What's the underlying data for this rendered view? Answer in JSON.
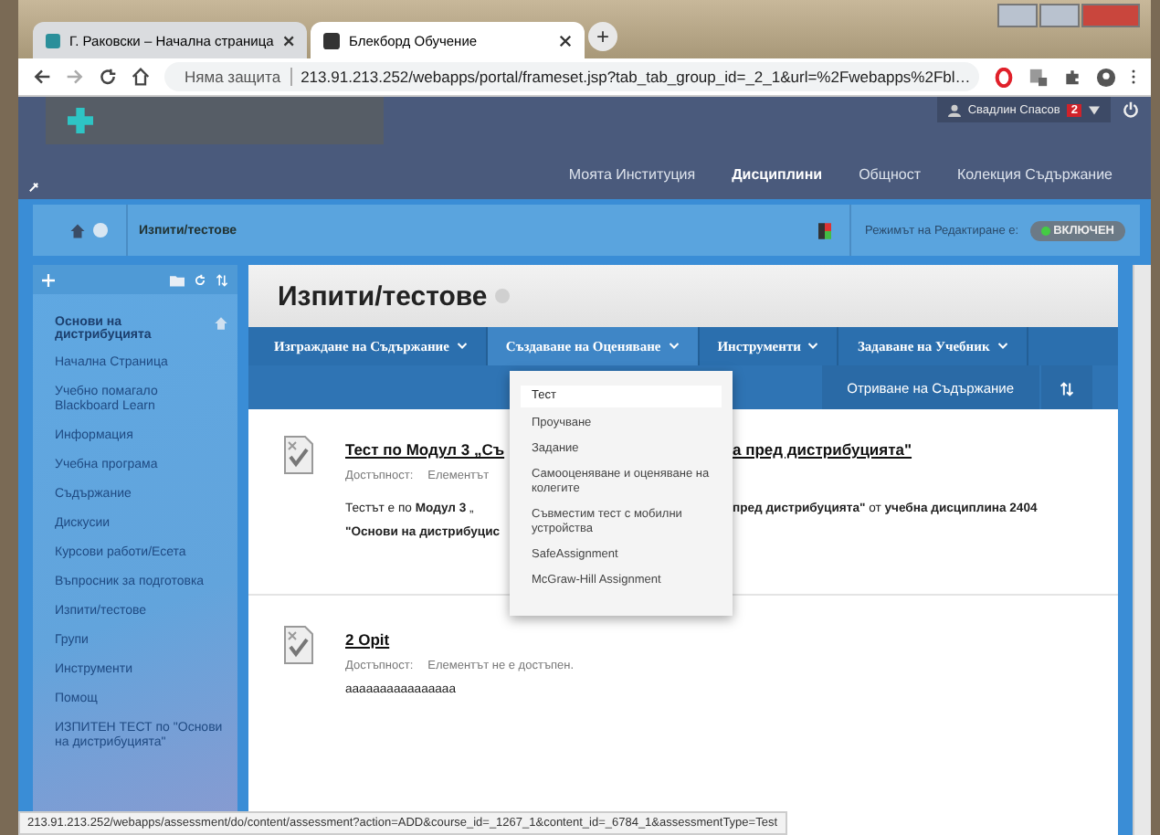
{
  "browser": {
    "tabs": [
      {
        "label": "Г. Раковски – Начална страница",
        "selected": false
      },
      {
        "label": "Блекборд Обучение",
        "selected": true
      }
    ],
    "new_tab": "+",
    "security": "Няма защита",
    "url": "213.91.213.252/webapps/portal/frameset.jsp?tab_tab_group_id=_2_1&url=%2Fwebapps%2Fbl…"
  },
  "header": {
    "user": "Свадлин Спасов",
    "notifications": "2",
    "nav": [
      {
        "label": "Моята Институция",
        "selected": false
      },
      {
        "label": "Дисциплини",
        "selected": true
      },
      {
        "label": "Общност",
        "selected": false
      },
      {
        "label": "Колекция Съдържание",
        "selected": false
      }
    ]
  },
  "breadcrumb": {
    "page": "Изпити/тестове",
    "edit_mode_label": "Режимът на Редактиране е:",
    "edit_mode": {
      "label": "ВКЛЮЧЕН",
      "on": true
    }
  },
  "sidebar": {
    "course": "Основи на дистрибуцията",
    "items": [
      "Начална Страница",
      "Учебно помагало Blackboard Learn",
      "Информация",
      "Учебна програма",
      "Съдържание",
      "Дискусии",
      "Курсови работи/Есета",
      "Въпросник за подготовка",
      "Изпити/тестове",
      "Групи",
      "Инструменти",
      "Помощ",
      "ИЗПИТЕН ТЕСТ по \"Основи на дистрибуцията\""
    ]
  },
  "content": {
    "title": "Изпити/тестове",
    "action_menus": [
      {
        "label": "Изграждане на Съдържание",
        "open": false
      },
      {
        "label": "Създаване на Оценяване",
        "open": true
      },
      {
        "label": "Инструменти",
        "open": false
      },
      {
        "label": "Задаване на Учебник",
        "open": false
      }
    ],
    "sort_button": "Отриване на Съдържание",
    "dropdown": [
      {
        "label": "Тест",
        "selected": true
      },
      {
        "label": "Проучване",
        "selected": false
      },
      {
        "label": "Задание",
        "selected": false
      },
      {
        "label": "Самооценяване и оценяване на колегите",
        "selected": false
      },
      {
        "label": "Съвместим тест с мобилни устройства",
        "selected": false
      },
      {
        "label": "SafeAssignment",
        "selected": false
      },
      {
        "label": "McGraw-Hill Assignment",
        "selected": false
      }
    ],
    "items": [
      {
        "title": [
          "Тест по Модул 3 „Съ",
          "а пред дистрибуцията\""
        ],
        "availability_label": "Достъпност:",
        "availability": [
          "Елементът"
        ],
        "body": [
          [
            "Тестът е по **Модул 3** „",
            "**пред дистрибуцията\"** от **учебна дисциплина 2404**"
          ],
          [
            "**\"Основи на дистрибуцис**"
          ]
        ]
      },
      {
        "title": [
          "2 Opit"
        ],
        "availability_label": "Достъпност:",
        "availability": [
          "Елементът не е достъпен."
        ],
        "body": [
          [
            "аааааааааааааааа"
          ]
        ]
      }
    ]
  },
  "status_bar": "213.91.213.252/webapps/assessment/do/content/assessment?action=ADD&course_id=_1267_1&content_id=_6784_1&assessmentType=Test"
}
